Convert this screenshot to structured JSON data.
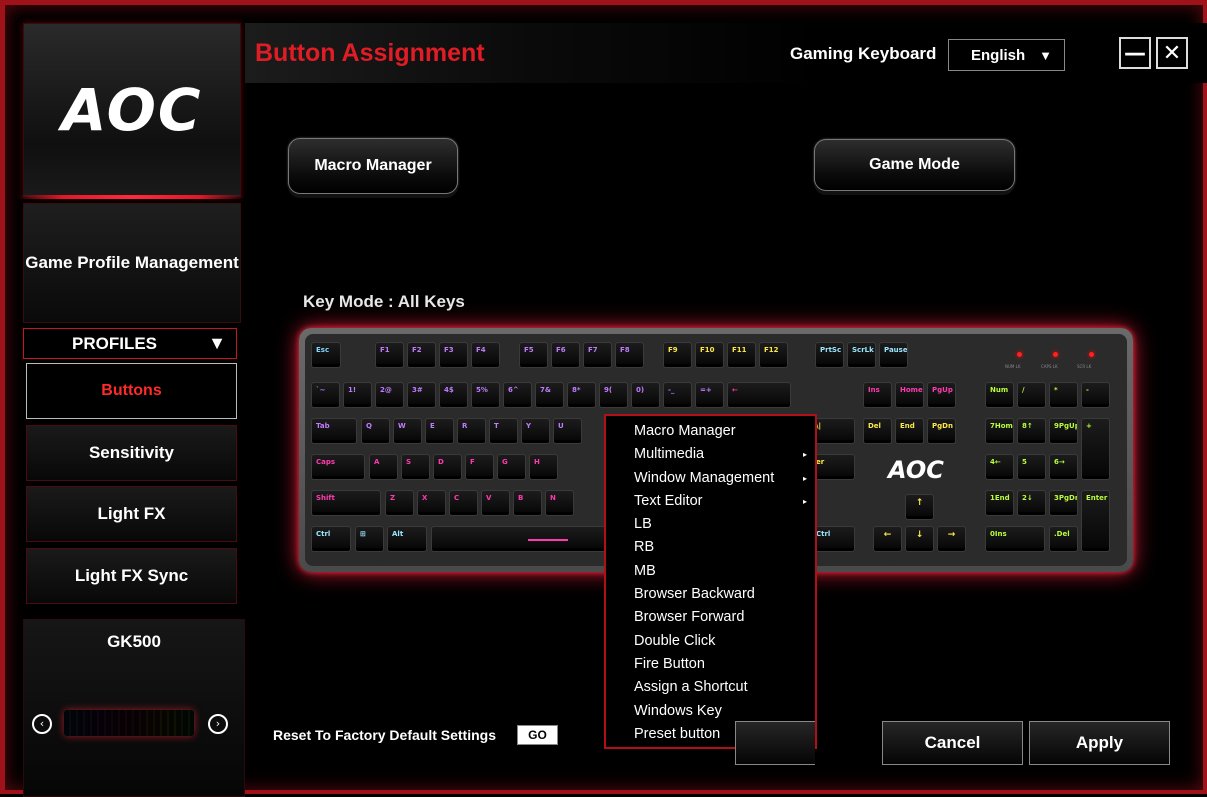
{
  "sidebar": {
    "logo": "AOC",
    "game_profile_management": "Game Profile Management",
    "profiles": {
      "label": "PROFILES",
      "arrow": "▼"
    },
    "nav": [
      "Buttons",
      "Sensitivity",
      "Light FX",
      "Light FX Sync"
    ],
    "device": {
      "name": "GK500",
      "prev": "‹",
      "next": "›"
    }
  },
  "header": {
    "title": "Button Assignment",
    "device_type": "Gaming Keyboard",
    "language": {
      "selected": "English",
      "arrow": "▼"
    },
    "minimize": "—",
    "close": "✕"
  },
  "main": {
    "macro_manager": "Macro Manager",
    "game_mode": "Game Mode",
    "key_mode": "Key Mode : All Keys",
    "keyboard_logo": "AOC"
  },
  "keyboard": {
    "rows": [
      [
        "Esc",
        "F1",
        "F2",
        "F3",
        "F4",
        "F5",
        "F6",
        "F7",
        "F8",
        "F9",
        "F10",
        "F11",
        "F12",
        "PrtSc",
        "ScrLk",
        "Pause"
      ],
      [
        "`~",
        "1!",
        "2@",
        "3#",
        "4$",
        "5%",
        "6^",
        "7&",
        "8*",
        "9(",
        "0)",
        "-_",
        "=+",
        "←",
        "Ins",
        "Home",
        "PgUp",
        "Num",
        "/",
        "*",
        "-"
      ],
      [
        "Tab",
        "Q",
        "W",
        "E",
        "R",
        "T",
        "Y",
        "U",
        "\\|",
        "Del",
        "End",
        "PgDn",
        "7Home",
        "8↑",
        "9PgUp",
        "+"
      ],
      [
        "Caps",
        "A",
        "S",
        "D",
        "F",
        "G",
        "H",
        "er",
        "4←",
        "5",
        "6→"
      ],
      [
        "Shift",
        "Z",
        "X",
        "C",
        "V",
        "B",
        "N",
        "1End",
        "2↓",
        "3PgDn",
        "Enter"
      ],
      [
        "Ctrl",
        "⊞",
        "Alt",
        "Ctrl",
        "0Ins",
        ".Del"
      ]
    ],
    "leds": [
      "NUM LK",
      "CAPS LK",
      "SCR LK"
    ],
    "colors": {
      "row1": "#9be6ff",
      "row2": "#c07cff",
      "row3": "#ff3ab0",
      "row4": "#ffb13a",
      "right": "#baff3a",
      "side": "#ffe84a"
    }
  },
  "context_menu": {
    "items": [
      {
        "label": "Macro Manager",
        "submenu": ""
      },
      {
        "label": "Multimedia",
        "submenu": "▸"
      },
      {
        "label": "Window Management",
        "submenu": "▸"
      },
      {
        "label": "Text Editor",
        "submenu": "▸"
      },
      {
        "label": "LB",
        "submenu": ""
      },
      {
        "label": "RB",
        "submenu": ""
      },
      {
        "label": "MB",
        "submenu": ""
      },
      {
        "label": "Browser Backward",
        "submenu": ""
      },
      {
        "label": "Browser Forward",
        "submenu": ""
      },
      {
        "label": "Double Click",
        "submenu": ""
      },
      {
        "label": "Fire Button",
        "submenu": ""
      },
      {
        "label": "Assign a Shortcut",
        "submenu": ""
      },
      {
        "label": "Windows Key",
        "submenu": ""
      },
      {
        "label": "Preset button",
        "submenu": ""
      }
    ]
  },
  "footer": {
    "reset_label": "Reset To Factory Default Settings",
    "go": "GO",
    "cancel": "Cancel",
    "apply": "Apply"
  },
  "theme": {
    "accent": "#e01c24",
    "border": "#a0121a"
  }
}
